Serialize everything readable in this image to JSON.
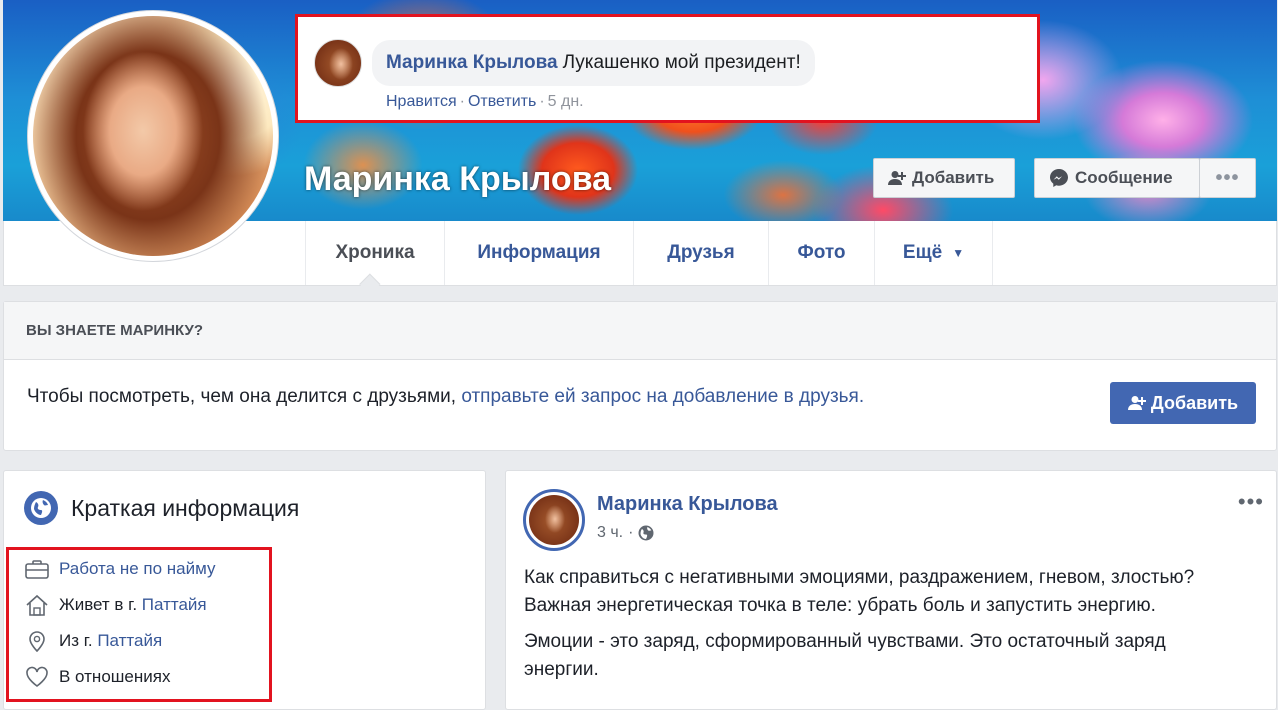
{
  "cover": {
    "name": "Маринка Крылова"
  },
  "header_buttons": {
    "add": "Добавить",
    "message": "Сообщение",
    "more": "•••"
  },
  "comment": {
    "author": "Маринка Крылова",
    "text": "Лукашенко мой президент!",
    "like": "Нравится",
    "reply": "Ответить",
    "time": "5 дн.",
    "sep": "·"
  },
  "tabs": [
    {
      "label": "Хроника"
    },
    {
      "label": "Информация"
    },
    {
      "label": "Друзья"
    },
    {
      "label": "Фото"
    },
    {
      "label": "Ещё"
    }
  ],
  "know": {
    "heading": "ВЫ ЗНАЕТЕ МАРИНКУ?",
    "text": "Чтобы посмотреть, чем она делится с друзьями,",
    "link": "отправьте ей запрос на добавление в друзья.",
    "button": "Добавить"
  },
  "intro": {
    "title": "Краткая информация",
    "items": [
      {
        "icon": "briefcase-icon",
        "prefix": "",
        "link": "Работа не по найму"
      },
      {
        "icon": "home-icon",
        "prefix": "Живет в г.",
        "link": "Паттайя"
      },
      {
        "icon": "location-pin-icon",
        "prefix": "Из г.",
        "link": "Паттайя"
      },
      {
        "icon": "heart-icon",
        "prefix": "В отношениях",
        "link": ""
      }
    ]
  },
  "post": {
    "author": "Маринка Крылова",
    "time": "3 ч.",
    "sep": "·",
    "more": "•••",
    "paragraphs": [
      "Как справиться с негативными эмоциями, раздражением, гневом, злостью? Важная энергетическая точка в теле: убрать боль и запустить энергию.",
      "Эмоции - это заряд, сформированный чувствами. Это остаточный заряд энергии."
    ]
  },
  "colors": {
    "brand": "#4267b2",
    "link": "#385898",
    "highlight": "#e2131f"
  }
}
